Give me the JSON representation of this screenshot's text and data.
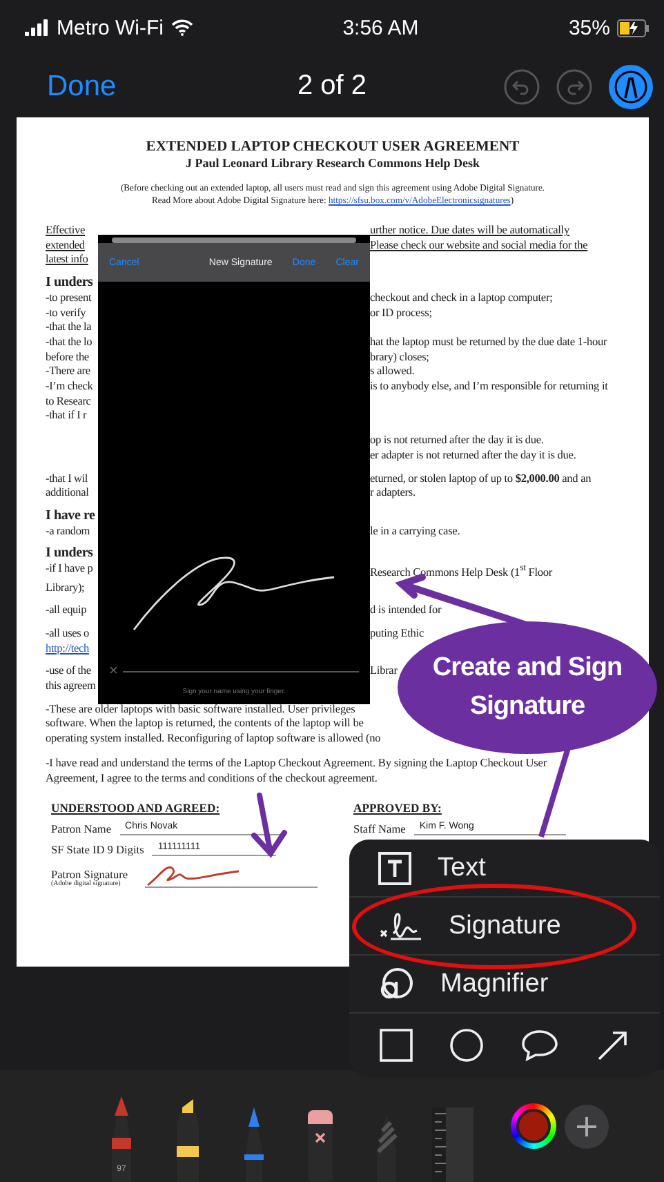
{
  "status_bar": {
    "carrier": "Metro Wi-Fi",
    "time": "3:56 AM",
    "battery": "35%"
  },
  "nav_bar": {
    "done": "Done",
    "title": "2 of 2",
    "markup_on": true
  },
  "document": {
    "title": "EXTENDED LAPTOP CHECKOUT USER AGREEMENT",
    "subtitle": "J Paul Leonard Library Research Commons Help Desk",
    "intro": "(Before checking out an extended laptop, all users must read and sign this agreement using Adobe Digital Signature.",
    "intro_more": "Read More about Adobe Digital Signature here: ",
    "intro_link": "https://sfsu.box.com/v/AdobeElectronicsignatures",
    "intro_close": ")",
    "paragraphs": [
      {
        "lines": [
          {
            "kind": "notice",
            "left": "Effective",
            "right": "urther notice. Due dates will be automatically"
          },
          {
            "kind": "notice",
            "left": "extended",
            "right": "Please check our website and social media for the"
          },
          {
            "kind": "notice",
            "left": "latest info"
          }
        ]
      },
      {
        "lines": [
          {
            "kind": "heading",
            "left": "I unders"
          },
          {
            "kind": "body",
            "left": "-to present",
            "right": "checkout and check in a laptop computer;"
          },
          {
            "kind": "body",
            "left": "-to verify",
            "right": "or ID process;"
          },
          {
            "kind": "body",
            "left": "-that the la"
          },
          {
            "kind": "body",
            "left": "-that the lo",
            "right": "hat the laptop must be returned by the due date 1-hour"
          },
          {
            "kind": "body",
            "left": "before the",
            "right": "brary) closes;"
          },
          {
            "kind": "body",
            "left": "-There are",
            "right": "s allowed."
          },
          {
            "kind": "body",
            "left": "-I’m check",
            "right": "is to anybody else, and I’m responsible for returning it"
          },
          {
            "kind": "body",
            "left": "to Researc"
          },
          {
            "kind": "body",
            "left": "-that if I r"
          }
        ]
      },
      {
        "lines": [
          {
            "kind": "body",
            "right": "op is not returned after the day it is due."
          },
          {
            "kind": "body",
            "right": "er adapter is not returned after the day it is due."
          }
        ]
      },
      {
        "lines": [
          {
            "kind": "body",
            "left": "-that I wil",
            "right": "eturned, or stolen laptop of up to **$2,000.00** and an"
          },
          {
            "kind": "body",
            "left": "additional",
            "right": "r adapters."
          }
        ]
      },
      {
        "lines": [
          {
            "kind": "heading",
            "left": "I have re"
          },
          {
            "kind": "body",
            "left": "-a random",
            "right": "le in a carrying case."
          }
        ]
      },
      {
        "lines": [
          {
            "kind": "heading",
            "left": "I unders"
          },
          {
            "kind": "body",
            "left": "-if I have p",
            "right": "Research Commons Help Desk (1$^{st}$ Floor"
          },
          {
            "kind": "body",
            "left": "Library);"
          }
        ]
      },
      {
        "lines": [
          {
            "kind": "body",
            "left": "-all equip",
            "right": "d is intended for"
          }
        ]
      },
      {
        "lines": [
          {
            "kind": "body",
            "left": "-all uses o",
            "right": "puting Ethic"
          },
          {
            "kind": "link",
            "left": "http://tech"
          }
        ]
      },
      {
        "lines": [
          {
            "kind": "body",
            "left": "-use of the",
            "right": "Librar"
          },
          {
            "kind": "body",
            "left": "this agreem"
          }
        ]
      }
    ],
    "wide_paragraphs": [
      [
        "-These are older laptops with basic software installed. User privileges",
        "software. When the laptop is returned, the contents of the laptop will be",
        "operating system installed. Reconfiguring of laptop software is allowed (no"
      ],
      [
        "-I have read and understand the terms of the Laptop Checkout Agreement. By signing the Laptop Checkout User",
        "Agreement, I agree to the terms and conditions of the checkout agreement."
      ]
    ],
    "form": {
      "left_heading": "UNDERSTOOD AND AGREED:",
      "right_heading": "APPROVED BY:",
      "patron_fields": [
        {
          "label": "Patron Name",
          "value": "Chris Novak"
        },
        {
          "label": "SF State ID 9 Digits",
          "value": "111111111"
        }
      ],
      "signature_label": "Patron Signature",
      "signature_note": "(Adobe digital signature)",
      "signed": true,
      "staff_fields": [
        {
          "label": "Staff Name",
          "value": "Kim F. Wong"
        }
      ]
    }
  },
  "signature_sheet": {
    "cancel": "Cancel",
    "title": "New Signature",
    "done": "Done",
    "clear": "Clear",
    "clear_mark": "×",
    "hint": "Sign your name using your finger."
  },
  "callout": {
    "lines": [
      "Create and Sign",
      "Signature"
    ]
  },
  "markup_menu": {
    "items": [
      {
        "kind": "text",
        "label": "Text",
        "highlighted": false
      },
      {
        "kind": "signature",
        "label": "Signature",
        "highlighted": true
      },
      {
        "kind": "magnifier",
        "label": "Magnifier",
        "highlighted": false
      }
    ]
  },
  "tools": {
    "items": [
      {
        "kind": "pen",
        "color": "#c0392b",
        "label": "97"
      },
      {
        "kind": "marker",
        "color": "#f2c94c"
      },
      {
        "kind": "pencil",
        "color": "#2f80ed"
      },
      {
        "kind": "eraser",
        "color": "#e8a0a0"
      },
      {
        "kind": "lasso",
        "color": "#555555"
      },
      {
        "kind": "ruler",
        "color": "#333333"
      }
    ],
    "color_well": {
      "color": "#a01a0a"
    }
  }
}
